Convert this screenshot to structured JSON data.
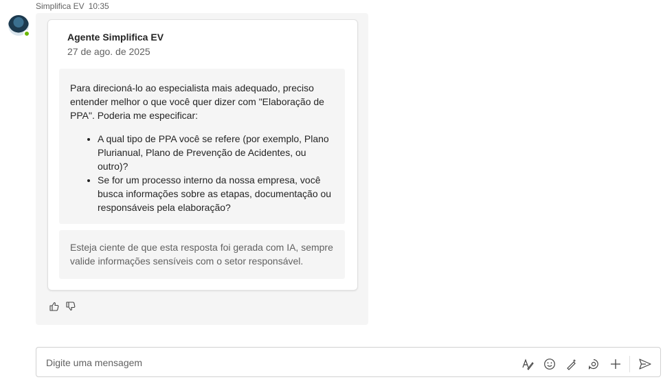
{
  "message": {
    "sender": "Simplifica EV",
    "time": "10:35"
  },
  "card": {
    "title": "Agente Simplifica EV",
    "date": "27 de ago. de 2025",
    "body_intro": "Para direcioná-lo ao especialista mais adequado, preciso entender melhor o que você quer dizer com \"Elaboração de PPA\". Poderia me especificar:",
    "bullets": [
      "A qual tipo de PPA você se refere (por exemplo, Plano Plurianual, Plano de Prevenção de Acidentes, ou outro)?",
      "Se for um processo interno da nossa empresa, você busca informações sobre as etapas, documentação ou responsáveis pela elaboração?"
    ],
    "disclaimer": "Esteja ciente de que esta resposta foi gerada com IA, sempre valide informações sensíveis com o setor responsável."
  },
  "composer": {
    "placeholder": "Digite uma mensagem"
  },
  "colors": {
    "presence": "#6bb700",
    "bubble": "#f5f5f5"
  }
}
